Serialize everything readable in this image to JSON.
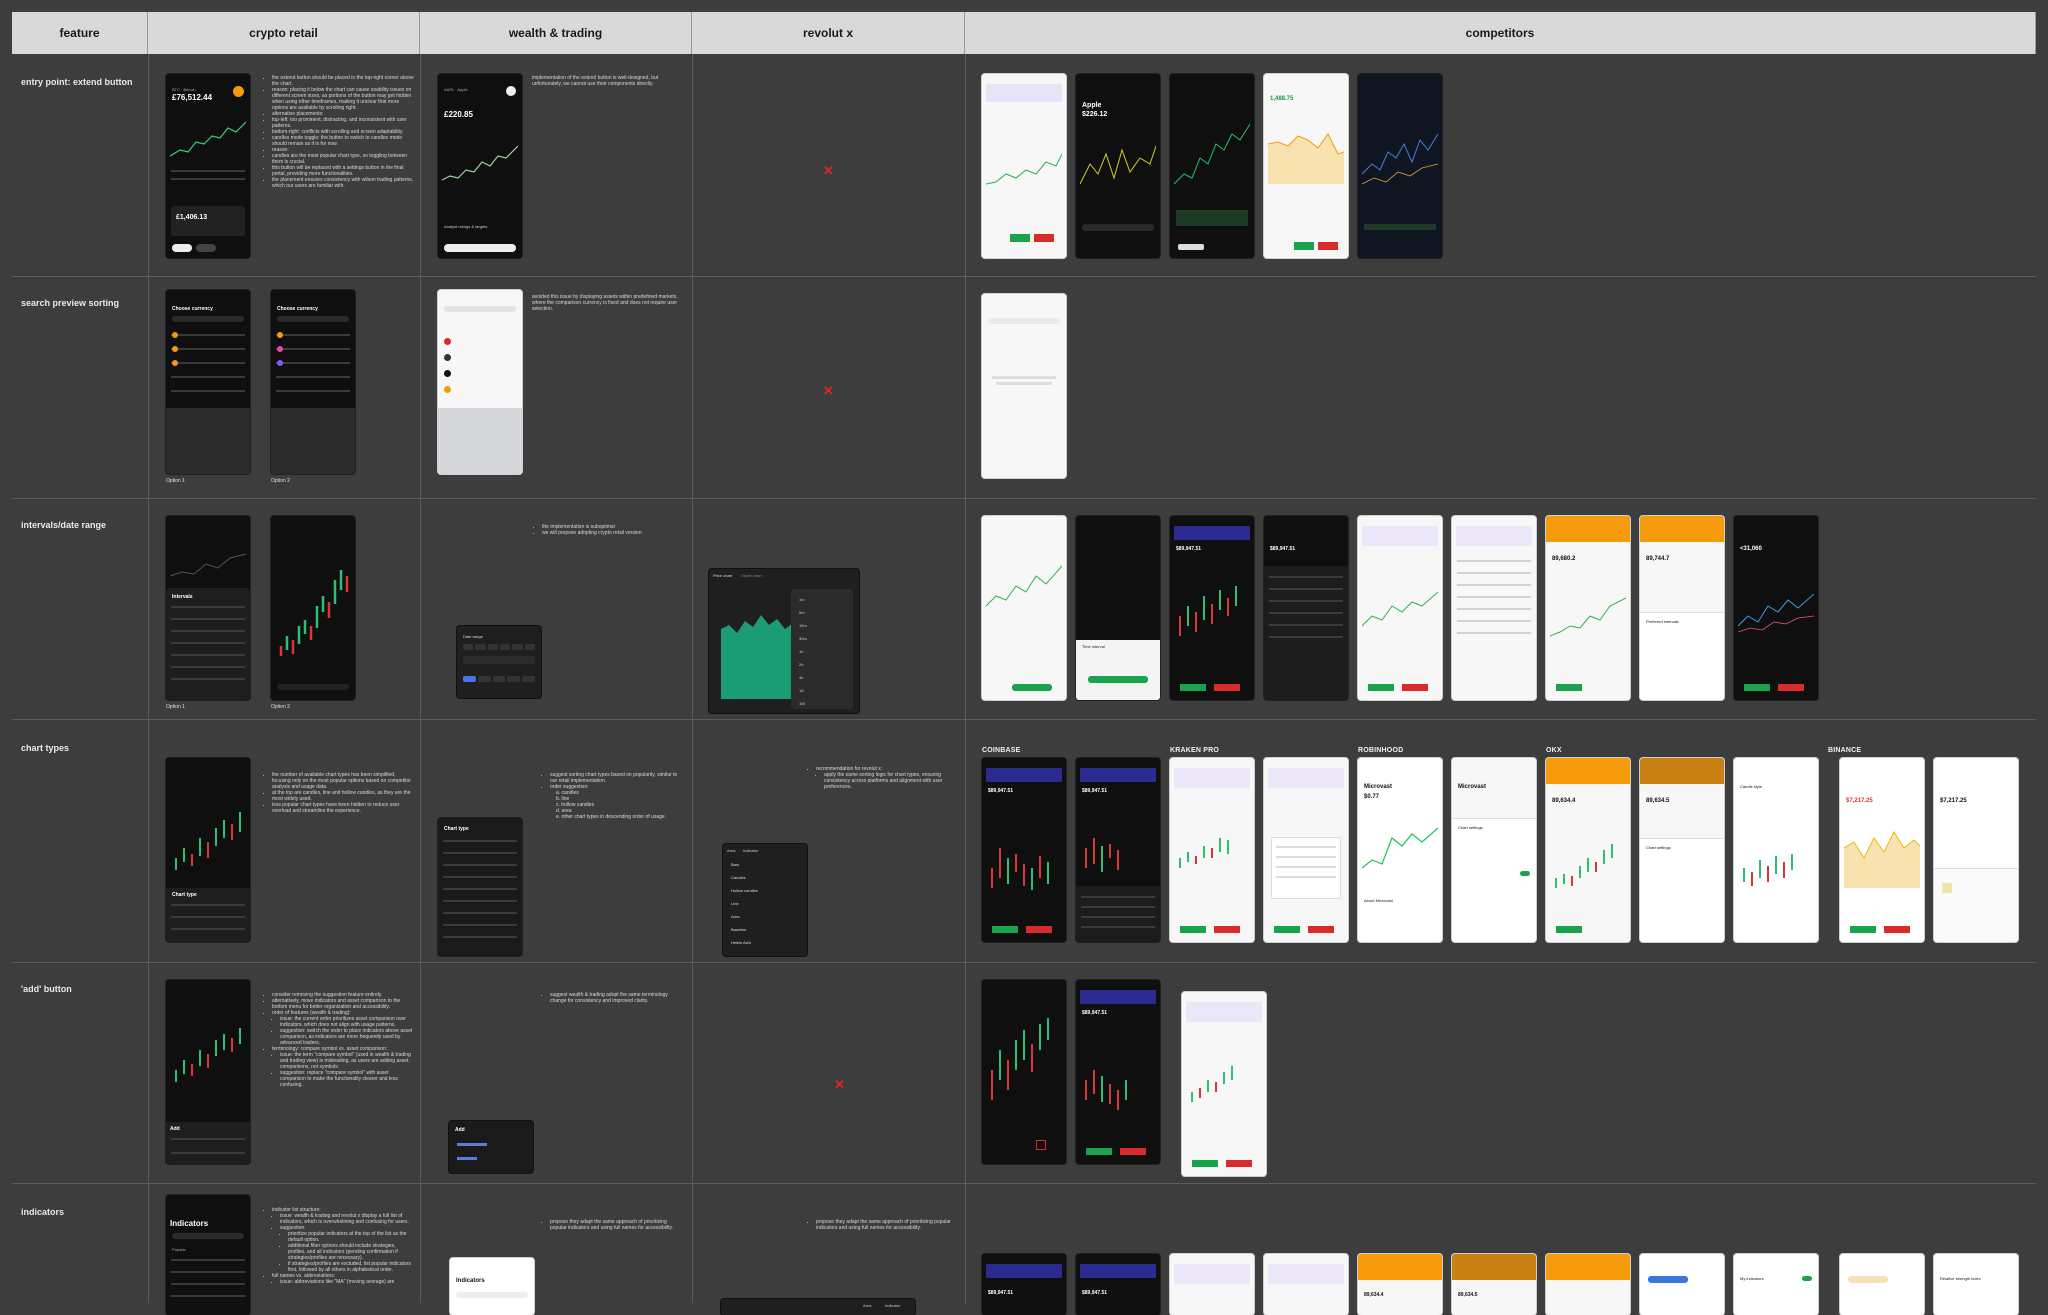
{
  "header": {
    "feature": "feature",
    "crypto_retail": "crypto retail",
    "wealth_trading": "wealth & trading",
    "revolut_x": "revolut x",
    "competitors": "competitors"
  },
  "rows": [
    {
      "label": "entry point: extend button"
    },
    {
      "label": "search preview sorting"
    },
    {
      "label": "intervals/date range"
    },
    {
      "label": "chart types"
    },
    {
      "label": "'add' button"
    },
    {
      "label": "indicators"
    }
  ],
  "notes": {
    "r1_crypto": [
      "the extend button should be placed in the top-right corner above the chart.",
      "reason: placing it below the chart can cause usability issues on different screen sizes, as portions of the button may get hidden when using other timeframes, making it unclear that more options are available by scrolling right.",
      "alternative placements:",
      "top-left: too prominent, distracting, and inconsistent with user patterns.",
      "bottom-right: conflicts with scrolling and screen adaptability.",
      "candles mode toggle: the button to switch to candles mode should remain as it is for now.",
      "reason:",
      "candles are the most popular chart type, so toggling between them is crucial.",
      "this button will be replaced with a settings button in the final portal, providing more functionalities.",
      "the placement ensures consistency with wilson trading patterns, which our users are familiar with."
    ],
    "r1_wealth": "implementation of the extend button is well-designed, but unfortunately, we cannot use their components directly.",
    "r2_wealth": "avoided this issue by displaying assets within predefined markets, where the comparison currency is fixed and does not require user selection.",
    "r3_wealth": [
      "the implementation is suboptimal",
      "we will propose adopting crypto retail version"
    ],
    "r4_crypto": [
      "the number of available chart types has been simplified, focusing only on the most popular options based on competitor analysis and usage data.",
      "at the top are candles, line and hollow candles, as they are the most widely used.",
      "less popular chart types have been hidden to reduce user overload and streamline the experience."
    ],
    "r4_wealth": [
      "suggest sorting chart types based on popularity, similar to our retail implementation.",
      "order suggestion:",
      "a. candles",
      "b. line",
      "c. hollow candles",
      "d. area",
      "e. other chart types in descending order of usage."
    ],
    "r4_revx": [
      "recommendation for revolut x:",
      "apply the same sorting logic for chart types, ensuring consistency across platforms and alignment with user preferences."
    ],
    "r5_crypto": [
      "consider removing the suggestion feature entirely.",
      "alternatively, move indicators and asset comparison to the bottom menu for better organization and accessibility.",
      "order of features (wealth & trading):",
      "issue: the current order prioritizes asset comparison over indicators, which does not align with usage patterns.",
      "suggestion: switch the order to place indicators above asset comparison, as indicators are more frequently used by advanced traders.",
      "terminology: compare symbol vs. asset comparison:",
      "issue: the term \"compare symbol\" (used in wealth & trading and trading view) is misleading, as users are adding asset comparisons, not symbols.",
      "suggestion: replace \"compare symbol\" with asset comparison to make the functionality clearer and less confusing."
    ],
    "r5_wealth": "suggest wealth & trading adopt the same terminology change for consistency and improved clarity.",
    "r6_crypto": [
      "indicator list structure:",
      "issue: wealth & trading and revolut x display a full list of indicators, which is overwhelming and confusing for users.",
      "suggestion:",
      "prioritize popular indicators at the top of the list as the default option.",
      "additional filter options should include strategies, profiles, and all indicators (pending confirmation if strategies/profiles are necessary).",
      "if strategies/profiles are excluded, list popular indicators first, followed by all others in alphabetical order.",
      "full names vs. abbreviations:",
      "issue: abbreviations like \"MA\" (moving average) are"
    ],
    "r6_wealth": "propose they adapt the same approach of prioritizing popular indicators and using full names for accessibility.",
    "r6_revx": "propose they adapt the same approach of prioritizing popular indicators and using full names for accessibility."
  },
  "phone_text": {
    "r1_crypto_price": "£76,512.44",
    "r1_crypto_asset": "BTC · Bitcoin",
    "r1_crypto_invest": "£1,406.13",
    "r1_wealth_asset": "AAPL · Apple",
    "r1_wealth_price": "£220.85",
    "r1_wealth_sub": "Analyst ratings & targets",
    "r2_title": "Choose currency",
    "r2_opt1": "Option 1",
    "r2_opt2": "Option 2",
    "r3_opt1": "Option 1",
    "r3_opt2": "Option 2",
    "r3_intervals": "Intervals",
    "r3_daterange": "Date range",
    "r4_sheet": "Chart type",
    "r4_wealth_sheet": "Chart type",
    "r5_sheet": "Add",
    "r5_wealth_sheet": "Add",
    "r6_title": "Indicators",
    "r6_popular": "Popular",
    "r6_wealth_title": "Indicators",
    "comp_apple": "Apple",
    "comp_apple_price": "$226.12",
    "comp_price1": "1,488.75",
    "comp_price2": "89,680.2",
    "comp_price3": "89,744.7",
    "comp_price4": "<31,060",
    "comp_price5": "$89,947.51",
    "comp_micro": "Microvast",
    "comp_micro_price": "$0.77",
    "comp_price6": "89,634.4",
    "comp_price7": "89,634.5",
    "comp_price8": "$7,217.25",
    "comp_time": "Time interval",
    "comp_chart_settings": "Chart settings",
    "comp_candle": "Candle style",
    "comp_pref": "Preferred intervals",
    "comp_my_ind": "My indicators",
    "comp_rsi": "Relative strength index",
    "comp_about": "About Microvast"
  },
  "revx": {
    "price_chart": "Price chart",
    "depth_chart": "Depth chart",
    "area": "Area",
    "indicator": "Indicator",
    "types": [
      "Bars",
      "Candles",
      "Hollow candles",
      "Line",
      "Area",
      "Baseline",
      "Heikin Ashi"
    ],
    "intervals": [
      "1m",
      "5m",
      "15m",
      "30m",
      "1h",
      "2h",
      "4h",
      "1D",
      "1W",
      "1M",
      "1Y"
    ]
  },
  "competitor_labels": {
    "coinbase": "COINBASE",
    "kraken": "KRAKEN PRO",
    "robinhood": "ROBINHOOD",
    "okx": "OKX",
    "binance": "BINANCE"
  },
  "x_mark": "✕",
  "colors": {
    "accent_orange": "#f59a0b",
    "buy_green": "#16a34a",
    "sell_red": "#dc2626",
    "header_gray": "#d9d9d9",
    "canvas": "#3d3d3d"
  }
}
